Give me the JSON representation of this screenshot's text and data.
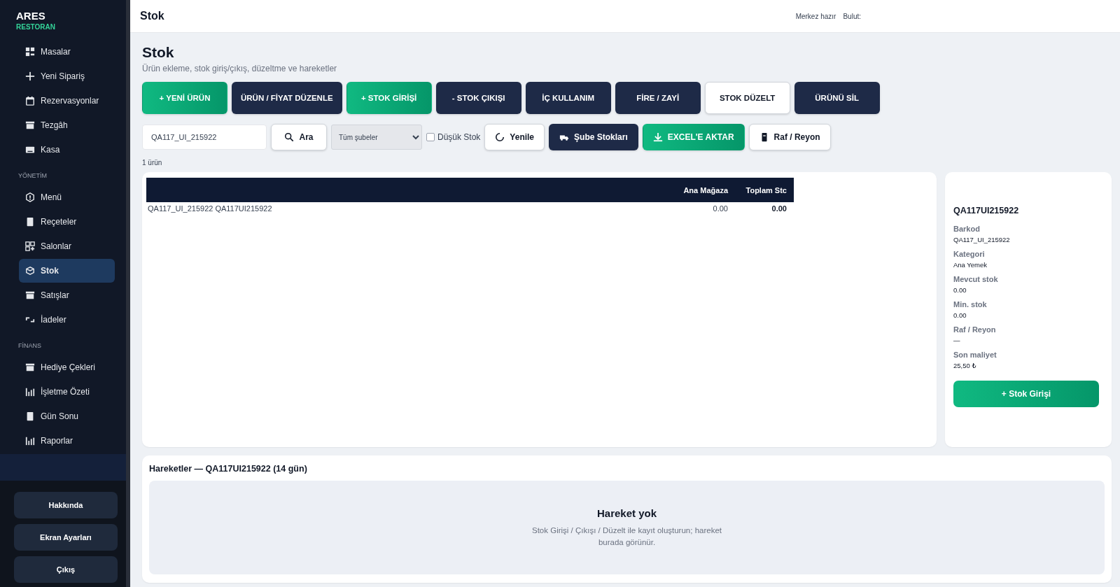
{
  "brand": {
    "name": "ARES",
    "subtitle": "RESTORAN"
  },
  "sidebar": {
    "sections": [
      {
        "items": [
          {
            "label": "Masalar",
            "kind": "grid",
            "selected": false
          },
          {
            "label": "Yeni Sipariş",
            "kind": "plus",
            "selected": false
          },
          {
            "label": "Rezervasyonlar",
            "kind": "calendar",
            "selected": false
          },
          {
            "label": "Tezgâh",
            "kind": "store",
            "selected": false
          },
          {
            "label": "Kasa",
            "kind": "register",
            "selected": false
          }
        ]
      },
      {
        "title": "YÖNETİM",
        "items": [
          {
            "label": "Menü",
            "kind": "hex",
            "selected": false
          },
          {
            "label": "Reçeteler",
            "kind": "doc",
            "selected": false
          },
          {
            "label": "Salonlar",
            "kind": "gridplus",
            "selected": false
          },
          {
            "label": "Stok",
            "kind": "box",
            "selected": true
          },
          {
            "label": "Satışlar",
            "kind": "store",
            "selected": false
          },
          {
            "label": "İadeler",
            "kind": "return",
            "selected": false
          }
        ]
      },
      {
        "title": "FİNANS",
        "items": [
          {
            "label": "Hediye Çekleri",
            "kind": "store",
            "selected": false
          },
          {
            "label": "İşletme Özeti",
            "kind": "bars",
            "selected": false
          },
          {
            "label": "Gün Sonu",
            "kind": "doc",
            "selected": false
          },
          {
            "label": "Raporlar",
            "kind": "bars",
            "selected": false
          }
        ]
      }
    ],
    "footer_buttons": [
      "Hakkında",
      "Ekran Ayarları",
      "Çıkış"
    ]
  },
  "top_bar": {
    "title": "Stok",
    "status": [
      "Merkez hazır",
      "Bulut:"
    ]
  },
  "page": {
    "title": "Stok",
    "subtitle": "Ürün ekleme, stok giriş/çıkış, düzeltme ve hareketler"
  },
  "actions": [
    {
      "label": "+ YENİ ÜRÜN",
      "kind": "green"
    },
    {
      "label": "ÜRÜN / FİYAT DÜZENLE",
      "kind": "dark"
    },
    {
      "label": "+ STOK GİRİŞİ",
      "kind": "green"
    },
    {
      "label": "- STOK ÇIKIŞI",
      "kind": "dark"
    },
    {
      "label": "İÇ KULLANIM",
      "kind": "dark"
    },
    {
      "label": "FİRE / ZAYİ",
      "kind": "dark"
    },
    {
      "label": "STOK DÜZELT",
      "kind": "white"
    },
    {
      "label": "ÜRÜNÜ SİL",
      "kind": "dark"
    }
  ],
  "filters": {
    "search": {
      "value": "QA117_UI_215922"
    },
    "search_button": "Ara",
    "branch": {
      "value": "Tüm şubeler"
    },
    "low_stock": {
      "label": "Düşük Stok",
      "checked": false
    },
    "buttons": [
      {
        "label": "Yenile",
        "kind": "white"
      },
      {
        "label": "Şube Stokları",
        "kind": "dark"
      },
      {
        "label": "EXCEL'E AKTAR",
        "kind": "green"
      },
      {
        "label": "Raf / Reyon",
        "kind": "white"
      }
    ]
  },
  "count": "1 ürün",
  "table": {
    "columns": [
      "Ana Mağaza",
      "Toplam Stc"
    ],
    "rows": [
      {
        "product": "QA117_UI_215922 QA117UI215922",
        "ana_magaza": "0.00",
        "toplam": "0.00"
      }
    ]
  },
  "detail": {
    "title": "QA117UI215922",
    "fields": [
      {
        "label": "Barkod",
        "value": "QA117_UI_215922"
      },
      {
        "label": "Kategori",
        "value": "Ana Yemek"
      },
      {
        "label": "Mevcut stok",
        "value": "0.00"
      },
      {
        "label": "Min. stok",
        "value": "0.00"
      },
      {
        "label": "Raf / Reyon",
        "value": "—"
      },
      {
        "label": "Son maliyet",
        "value": "25,50 ₺"
      }
    ],
    "button": "+ Stok Girişi"
  },
  "movements": {
    "title": "Hareketler — QA117UI215922 (14 gün)",
    "empty_title": "Hareket yok",
    "empty_text": "Stok Girişi / Çıkışı / Düzelt ile kayıt oluşturun; hareket burada görünür."
  }
}
